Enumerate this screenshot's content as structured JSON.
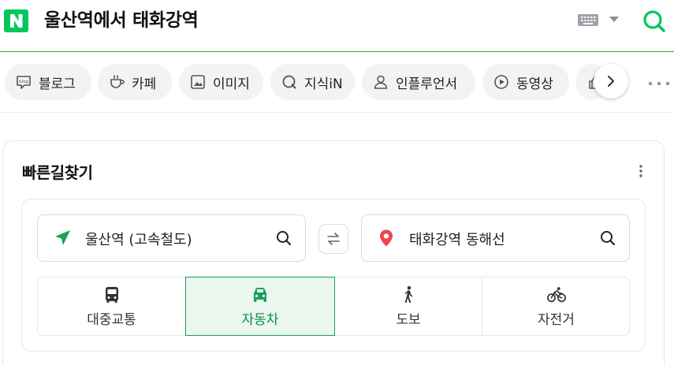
{
  "header": {
    "logo_icon": "naver-n-logo",
    "query": "울산역에서 태화강역",
    "keyboard_icon": "keyboard-icon",
    "search_icon": "search-icon",
    "accent": "#03c75a"
  },
  "tabs": [
    {
      "label": "블로그",
      "icon": "blog-icon"
    },
    {
      "label": "카페",
      "icon": "cafe-cup-icon"
    },
    {
      "label": "이미지",
      "icon": "image-icon"
    },
    {
      "label": "지식iN",
      "icon": "kin-icon"
    },
    {
      "label": "인플루언서",
      "icon": "person-icon"
    },
    {
      "label": "동영상",
      "icon": "play-icon"
    },
    {
      "label": "",
      "icon": "thumb-icon"
    }
  ],
  "route": {
    "title": "빠른길찾기",
    "origin": "울산역 (고속철도)",
    "destination": "태화강역 동해선",
    "modes": [
      {
        "label": "대중교통",
        "icon": "bus-icon",
        "active": false
      },
      {
        "label": "자동차",
        "icon": "car-icon",
        "active": true
      },
      {
        "label": "도보",
        "icon": "walk-icon",
        "active": false
      },
      {
        "label": "자전거",
        "icon": "bicycle-icon",
        "active": false
      }
    ]
  }
}
